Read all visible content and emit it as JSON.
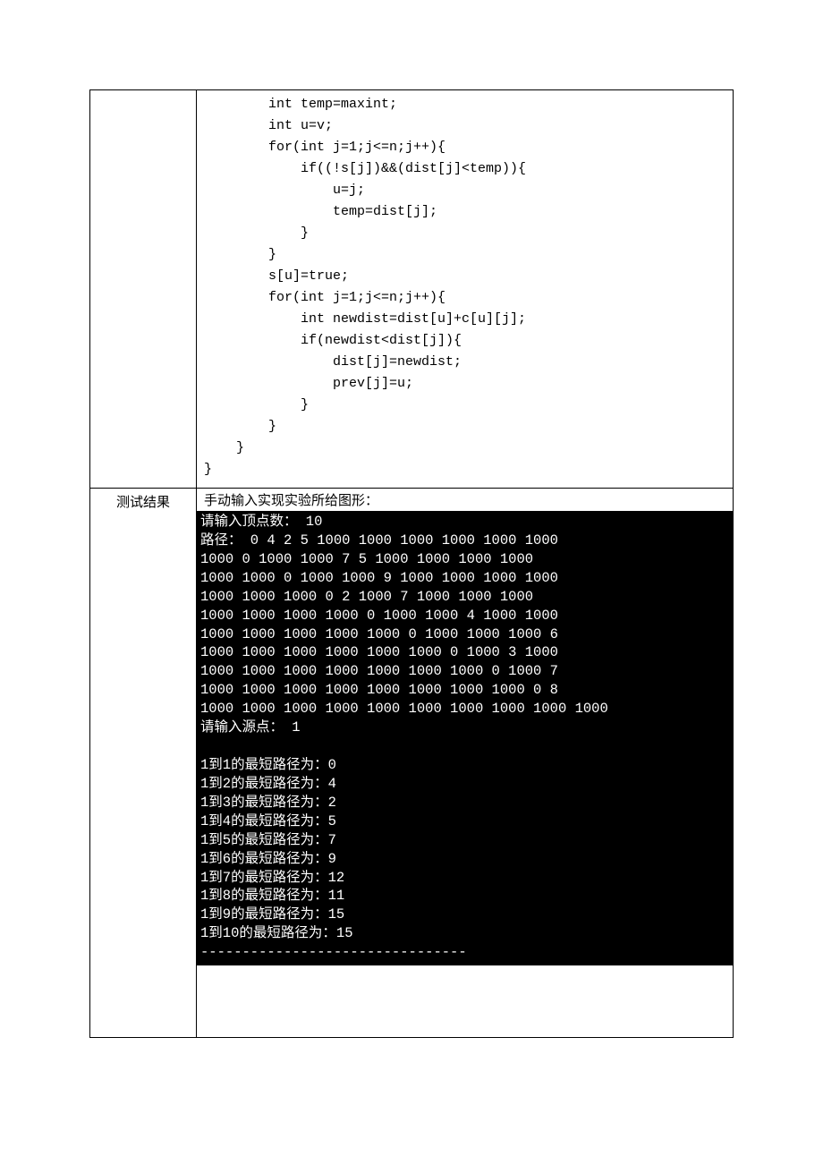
{
  "row1": {
    "label": "",
    "code": "        int temp=maxint;\n        int u=v;\n        for(int j=1;j<=n;j++){\n            if((!s[j])&&(dist[j]<temp)){\n                u=j;\n                temp=dist[j];\n            }\n        }\n        s[u]=true;\n        for(int j=1;j<=n;j++){\n            int newdist=dist[u]+c[u][j];\n            if(newdist<dist[j]){\n                dist[j]=newdist;\n                prev[j]=u;\n            }\n        }\n    }\n}"
  },
  "row2": {
    "label": "测试结果",
    "desc": "手动输入实现实验所给图形：",
    "terminal": "请输入顶点数： 10\n路径： 0 4 2 5 1000 1000 1000 1000 1000 1000\n1000 0 1000 1000 7 5 1000 1000 1000 1000\n1000 1000 0 1000 1000 9 1000 1000 1000 1000\n1000 1000 1000 0 2 1000 7 1000 1000 1000\n1000 1000 1000 1000 0 1000 1000 4 1000 1000\n1000 1000 1000 1000 1000 0 1000 1000 1000 6\n1000 1000 1000 1000 1000 1000 0 1000 3 1000\n1000 1000 1000 1000 1000 1000 1000 0 1000 7\n1000 1000 1000 1000 1000 1000 1000 1000 0 8\n1000 1000 1000 1000 1000 1000 1000 1000 1000 1000\n请输入源点： 1\n\n1到1的最短路径为：0\n1到2的最短路径为：4\n1到3的最短路径为：2\n1到4的最短路径为：5\n1到5的最短路径为：7\n1到6的最短路径为：9\n1到7的最短路径为：12\n1到8的最短路径为：11\n1到9的最短路径为：15\n1到10的最短路径为：15\n--------------------------------"
  }
}
